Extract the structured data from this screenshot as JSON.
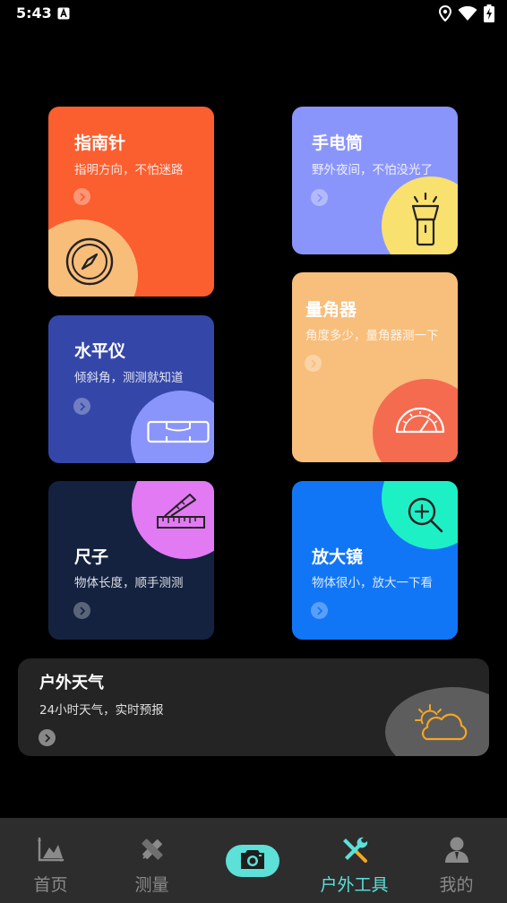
{
  "status": {
    "time": "5:43"
  },
  "cards": {
    "compass": {
      "title": "指南针",
      "subtitle": "指明方向，不怕迷路",
      "color": "#fb5e2f"
    },
    "flashlight": {
      "title": "手电筒",
      "subtitle": "野外夜间，不怕没光了",
      "color": "#8a95fb"
    },
    "protractor": {
      "title": "量角器",
      "subtitle": "角度多少，量角器测一下",
      "color": "#f8be7b"
    },
    "level": {
      "title": "水平仪",
      "subtitle": "倾斜角，测测就知道",
      "color": "#3447a8"
    },
    "ruler": {
      "title": "尺子",
      "subtitle": "物体长度，顺手测测",
      "color": "#142240"
    },
    "magnifier": {
      "title": "放大镜",
      "subtitle": "物体很小，放大一下看",
      "color": "#1176f6"
    }
  },
  "weather": {
    "title": "户外天气",
    "subtitle": "24小时天气，实时预报"
  },
  "tabbar": {
    "home": "首页",
    "measure": "测量",
    "outdoor": "户外工具",
    "mine": "我的",
    "active": "户外工具",
    "active_color": "#5ce0d8"
  }
}
